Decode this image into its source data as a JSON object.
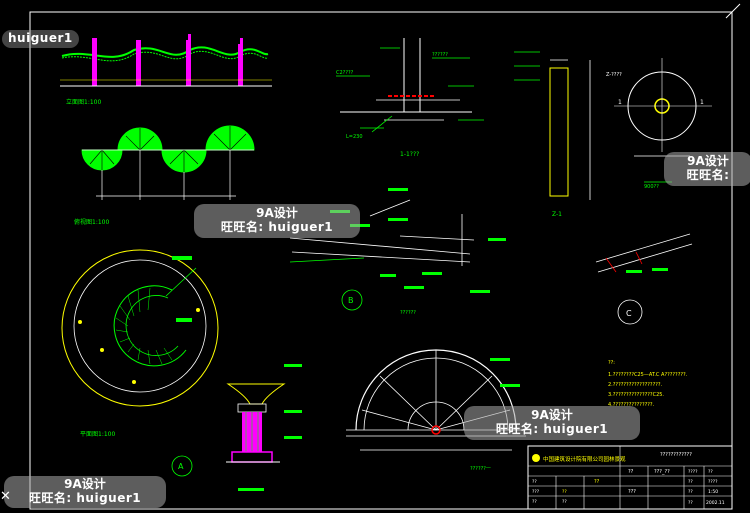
{
  "watermark": {
    "brand": "9A设计",
    "contact": "旺旺名: huiguer1",
    "contact_short": "旺旺名:",
    "contact_partial": "旺旺名: huiguer1",
    "partial_top": "huiguer1"
  },
  "labels": {
    "elevation": "立面图1:100",
    "plan_small": "俯视图1:100",
    "plan_round": "平面图1:100",
    "section_1": "1-1???",
    "dim_230": "L=230",
    "z1_label": "Z-1",
    "z_label_top": "Z-????",
    "dim_left": "C2????",
    "dim_beam": "??????",
    "circle_b": "B",
    "circle_c": "C",
    "circle_a": "A",
    "caption_b": "??????",
    "caption_fan": "??????一",
    "dim_900": "900??",
    "num_1_left": "1",
    "num_1_right": "1"
  },
  "notes": {
    "title": "??:",
    "lines": [
      "1.????????C25—AT.C A????????.",
      "2.??????????????????.",
      "3.???????????????C25.",
      "4.???????????????."
    ]
  },
  "title_block": {
    "company": "中国建筑设计院有限公司园林景观",
    "project": "????????????",
    "sheet_name": "??",
    "scale_label": "1:50",
    "sheet_no": "2002.11",
    "design": "??",
    "check": "???",
    "approve": "??",
    "drawing": "??",
    "date_label": "??",
    "row_vals": [
      "????",
      "??",
      "??",
      "????",
      "??",
      "??"
    ],
    "code_a": "???_??",
    "code_b": "??",
    "code_c": "???"
  },
  "colors": {
    "magenta": "#ff00ff",
    "green": "#00ff00",
    "yellow": "#ffff00",
    "white": "#ffffff",
    "red": "#ff0000",
    "cyan": "#00ffff"
  },
  "close_icon": "close-x-icon"
}
